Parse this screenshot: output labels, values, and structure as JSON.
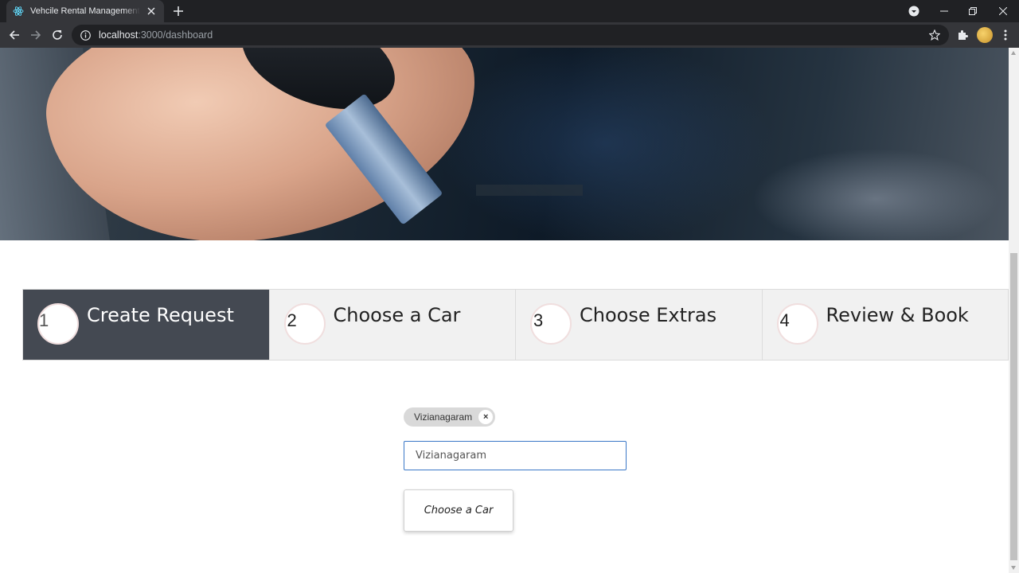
{
  "browser": {
    "tab_title": "Vehcile Rental Management System",
    "url_host": "localhost",
    "url_path": ":3000/dashboard"
  },
  "stepper": {
    "steps": [
      {
        "number": "1",
        "label": "Create Request",
        "active": true
      },
      {
        "number": "2",
        "label": "Choose a Car",
        "active": false
      },
      {
        "number": "3",
        "label": "Choose Extras",
        "active": false
      },
      {
        "number": "4",
        "label": "Review & Book",
        "active": false
      }
    ]
  },
  "form": {
    "selected_city_chip": "Vizianagaram",
    "chip_remove": "×",
    "city_input_value": "Vizianagaram",
    "choose_car_button": "Choose a Car"
  },
  "colors": {
    "active_step_bg": "#444952",
    "inactive_step_bg": "#f1f1f1",
    "input_focus_border": "#3b78c7"
  }
}
